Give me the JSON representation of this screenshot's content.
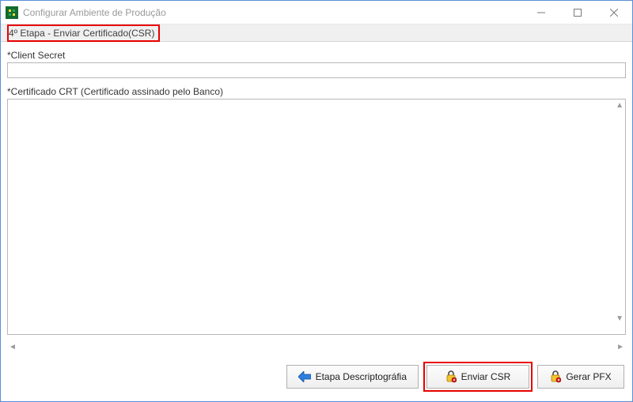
{
  "window": {
    "title": "Configurar Ambiente de Produção"
  },
  "step": {
    "label": "4º Etapa - Enviar Certificado(CSR)"
  },
  "fields": {
    "client_secret_label": "*Client Secret",
    "client_secret_value": "",
    "crt_label": "*Certificado CRT (Certificado assinado pelo Banco)",
    "crt_value": ""
  },
  "buttons": {
    "prev": "Etapa Descriptográfia",
    "send": "Enviar CSR",
    "pfx": "Gerar PFX"
  },
  "icons": {
    "app": "app-icon",
    "min": "minimize-icon",
    "max": "maximize-icon",
    "close": "close-icon",
    "arrow_left": "arrow-left-icon",
    "lock": "lock-icon"
  },
  "colors": {
    "highlight": "#e60000",
    "window_border": "#5a8fd6"
  }
}
